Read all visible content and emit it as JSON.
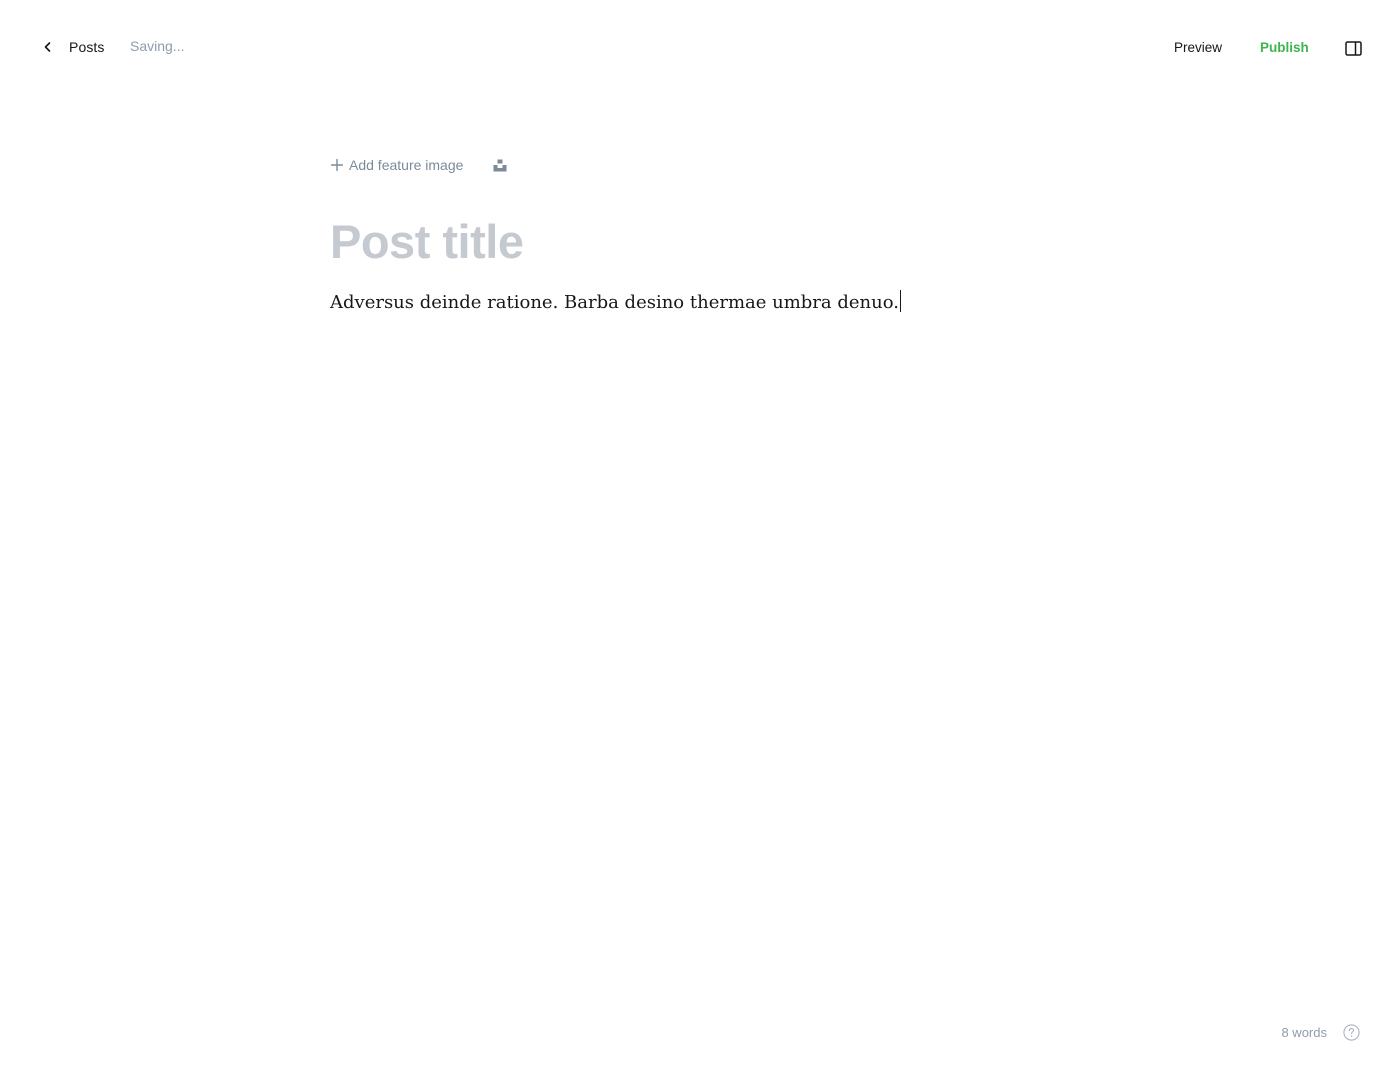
{
  "header": {
    "back_label": "Posts",
    "status": "Saving...",
    "preview_label": "Preview",
    "publish_label": "Publish"
  },
  "editor": {
    "add_feature_label": "Add feature image",
    "title_placeholder": "Post title",
    "body": "Adversus deinde ratione. Barba desino thermae umbra denuo."
  },
  "footer": {
    "word_count": "8 words"
  },
  "icons": {
    "back": "chevron-left-icon",
    "sidebar": "sidebar-toggle-icon",
    "plus": "plus-icon",
    "unsplash": "unsplash-icon",
    "help": "help-circle-icon"
  },
  "colors": {
    "publish": "#3eb54f",
    "muted": "#8e9cac",
    "title_placeholder": "#c5cad0",
    "text": "#15171a"
  }
}
